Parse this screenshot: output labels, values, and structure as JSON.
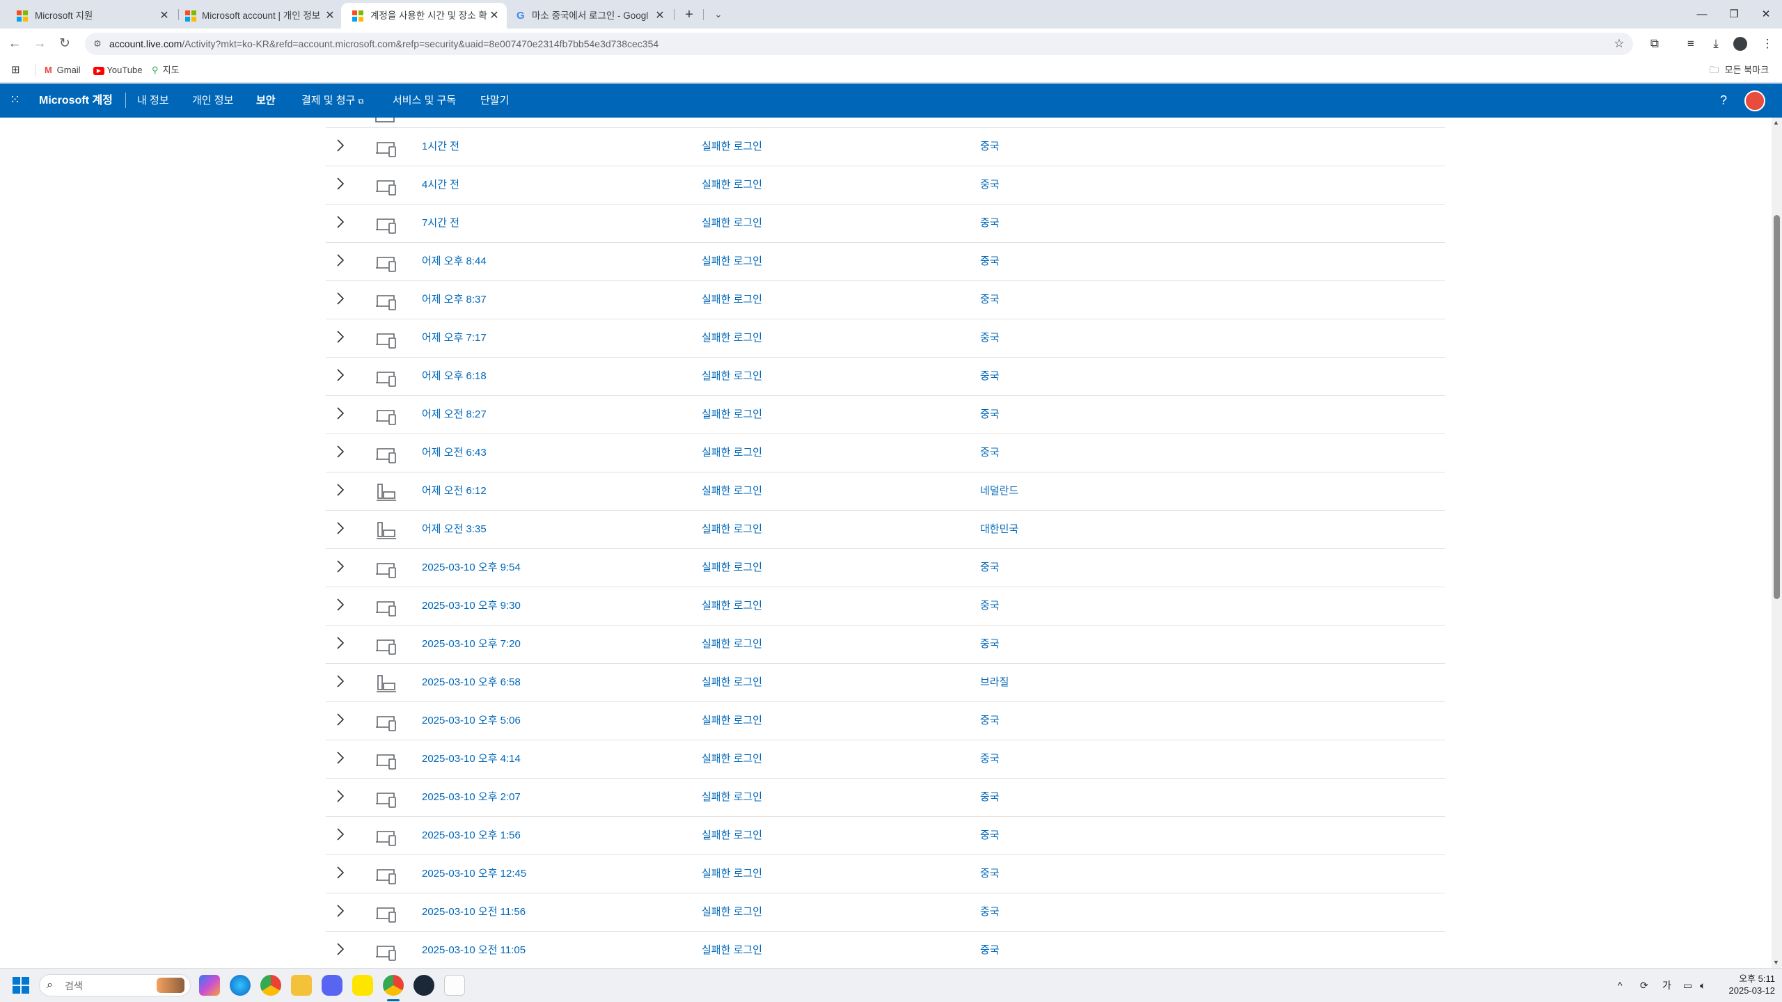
{
  "browser": {
    "tabs": [
      {
        "title": "Microsoft 지원",
        "active": false
      },
      {
        "title": "Microsoft account | 개인 정보",
        "active": false
      },
      {
        "title": "계정을 사용한 시간 및 장소 확",
        "active": true
      },
      {
        "title": "마소 중국에서 로그인 - Googl",
        "active": false
      }
    ],
    "new_tab": "+",
    "url_domain": "account.live.com",
    "url_rest": "/Activity?mkt=ko-KR&refd=account.microsoft.com&refp=security&uaid=8e007470e2314fb7bb54e3d738cec354",
    "bookmarks": [
      {
        "label": "Gmail",
        "icon": "gmail-icon"
      },
      {
        "label": "YouTube",
        "icon": "youtube-icon"
      },
      {
        "label": "지도",
        "icon": "maps-icon"
      }
    ],
    "all_bookmarks": "모든 북마크"
  },
  "ms_header": {
    "brand": "Microsoft 계정",
    "nav": [
      {
        "label": "내 정보",
        "active": false
      },
      {
        "label": "개인 정보",
        "active": false
      },
      {
        "label": "보안",
        "active": true
      },
      {
        "label": "결제 및 청구",
        "active": false,
        "external": true
      },
      {
        "label": "서비스 및 구독",
        "active": false
      },
      {
        "label": "단말기",
        "active": false
      }
    ],
    "help": "?"
  },
  "activity": {
    "rows": [
      {
        "time": "1시간 전",
        "status": "실패한 로그인",
        "location": "중국",
        "device": "phone"
      },
      {
        "time": "4시간 전",
        "status": "실패한 로그인",
        "location": "중국",
        "device": "phone"
      },
      {
        "time": "7시간 전",
        "status": "실패한 로그인",
        "location": "중국",
        "device": "phone"
      },
      {
        "time": "어제 오후 8:44",
        "status": "실패한 로그인",
        "location": "중국",
        "device": "phone"
      },
      {
        "time": "어제 오후 8:37",
        "status": "실패한 로그인",
        "location": "중국",
        "device": "phone"
      },
      {
        "time": "어제 오후 7:17",
        "status": "실패한 로그인",
        "location": "중국",
        "device": "phone"
      },
      {
        "time": "어제 오후 6:18",
        "status": "실패한 로그인",
        "location": "중국",
        "device": "phone"
      },
      {
        "time": "어제 오전 8:27",
        "status": "실패한 로그인",
        "location": "중국",
        "device": "phone"
      },
      {
        "time": "어제 오전 6:43",
        "status": "실패한 로그인",
        "location": "중국",
        "device": "phone"
      },
      {
        "time": "어제 오전 6:12",
        "status": "실패한 로그인",
        "location": "네덜란드",
        "device": "computer"
      },
      {
        "time": "어제 오전 3:35",
        "status": "실패한 로그인",
        "location": "대한민국",
        "device": "computer"
      },
      {
        "time": "2025-03-10 오후 9:54",
        "status": "실패한 로그인",
        "location": "중국",
        "device": "phone"
      },
      {
        "time": "2025-03-10 오후 9:30",
        "status": "실패한 로그인",
        "location": "중국",
        "device": "phone"
      },
      {
        "time": "2025-03-10 오후 7:20",
        "status": "실패한 로그인",
        "location": "중국",
        "device": "phone"
      },
      {
        "time": "2025-03-10 오후 6:58",
        "status": "실패한 로그인",
        "location": "브라질",
        "device": "computer"
      },
      {
        "time": "2025-03-10 오후 5:06",
        "status": "실패한 로그인",
        "location": "중국",
        "device": "phone"
      },
      {
        "time": "2025-03-10 오후 4:14",
        "status": "실패한 로그인",
        "location": "중국",
        "device": "phone"
      },
      {
        "time": "2025-03-10 오후 2:07",
        "status": "실패한 로그인",
        "location": "중국",
        "device": "phone"
      },
      {
        "time": "2025-03-10 오후 1:56",
        "status": "실패한 로그인",
        "location": "중국",
        "device": "phone"
      },
      {
        "time": "2025-03-10 오후 12:45",
        "status": "실패한 로그인",
        "location": "중국",
        "device": "phone"
      },
      {
        "time": "2025-03-10 오전 11:56",
        "status": "실패한 로그인",
        "location": "중국",
        "device": "phone"
      },
      {
        "time": "2025-03-10 오전 11:05",
        "status": "실패한 로그인",
        "location": "중국",
        "device": "phone"
      }
    ]
  },
  "taskbar": {
    "search_placeholder": "검색",
    "ime": "가",
    "clock_time": "오후 5:11",
    "clock_date": "2025-03-12"
  },
  "colors": {
    "accent": "#0067b8",
    "link": "#0067b8",
    "tabstrip": "#dfe3eb"
  }
}
